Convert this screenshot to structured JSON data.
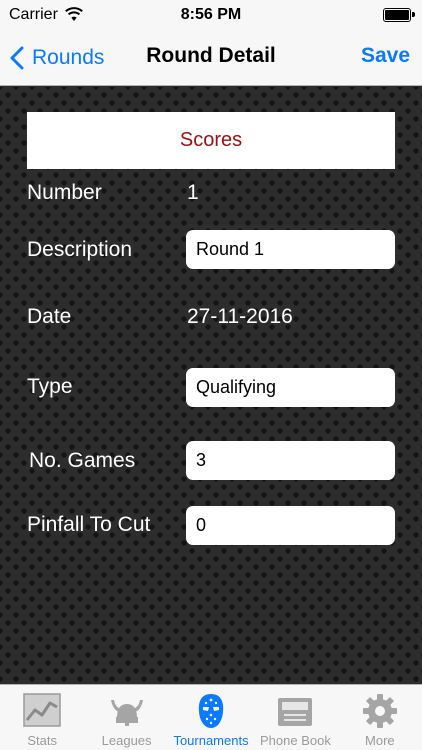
{
  "status_bar": {
    "carrier": "Carrier",
    "time": "8:56 PM"
  },
  "nav": {
    "back_label": "Rounds",
    "title": "Round Detail",
    "save_label": "Save"
  },
  "scores_button": {
    "label": "Scores"
  },
  "form": {
    "number": {
      "label": "Number",
      "value": "1"
    },
    "description": {
      "label": "Description",
      "value": "Round 1"
    },
    "date": {
      "label": "Date",
      "value": "27-11-2016"
    },
    "type": {
      "label": "Type",
      "value": "Qualifying"
    },
    "games": {
      "label": "No. Games",
      "value": "3"
    },
    "pinfall": {
      "label": "Pinfall To Cut",
      "value": "0"
    }
  },
  "tabs": [
    {
      "label": "Stats",
      "icon": "stats-chart-icon",
      "active": false
    },
    {
      "label": "Leagues",
      "icon": "viking-helmet-icon",
      "active": false
    },
    {
      "label": "Tournaments",
      "icon": "hockey-mask-icon",
      "active": true
    },
    {
      "label": "Phone Book",
      "icon": "phone-book-icon",
      "active": false
    },
    {
      "label": "More",
      "icon": "gear-icon",
      "active": false
    }
  ],
  "colors": {
    "accent": "#0a7aff",
    "scores_text": "#9b1111",
    "tab_inactive": "#9a9a9a"
  }
}
